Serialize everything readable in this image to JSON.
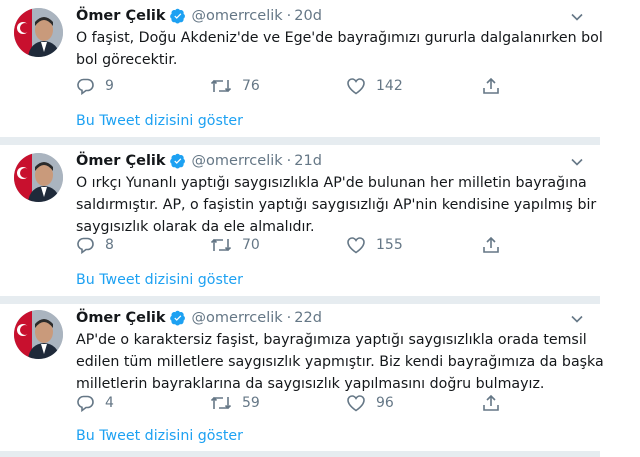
{
  "tweets": [
    {
      "name": "Ömer Çelik",
      "handle": "@omerrcelik",
      "separator": "·",
      "time": "20d",
      "lines": [
        "O faşist, Doğu Akdeniz'de ve Ege'de bayrağımızı gururla dalgalanırken bol",
        "bol görecektir."
      ],
      "replies": "9",
      "retweets": "76",
      "likes": "142",
      "thread_link": "Bu Tweet dizisini göster"
    },
    {
      "name": "Ömer Çelik",
      "handle": "@omerrcelik",
      "separator": "·",
      "time": "21d",
      "lines": [
        "O ırkçı Yunanlı yaptığı saygısızlıkla AP'de bulunan her milletin bayrağına",
        "saldırmıştır. AP, o faşistin yaptığı saygısızlığı AP'nin kendisine yapılmış bir",
        "saygısızlık olarak da ele almalıdır."
      ],
      "replies": "8",
      "retweets": "70",
      "likes": "155",
      "thread_link": "Bu Tweet dizisini göster"
    },
    {
      "name": "Ömer Çelik",
      "handle": "@omerrcelik",
      "separator": "·",
      "time": "22d",
      "lines": [
        "AP'de o karaktersiz faşist, bayrağımıza yaptığı saygısızlıkla orada temsil",
        "edilen tüm milletlere saygısızlık yapmıştır. Biz kendi bayrağımıza da başka",
        "milletlerin bayraklarına da saygısızlık yapılmasını doğru bulmayız."
      ],
      "replies": "4",
      "retweets": "59",
      "likes": "96",
      "thread_link": "Bu Tweet dizisini göster"
    }
  ],
  "icons": {
    "reply": "reply-icon",
    "retweet": "retweet-icon",
    "like": "heart-icon",
    "share": "share-icon",
    "verified": "verified-badge-icon",
    "caret": "chevron-down-icon"
  },
  "colors": {
    "link": "#1da1f2",
    "secondary_text": "#657786",
    "verified": "#1da1f2",
    "divider": "#e6ecf0"
  }
}
